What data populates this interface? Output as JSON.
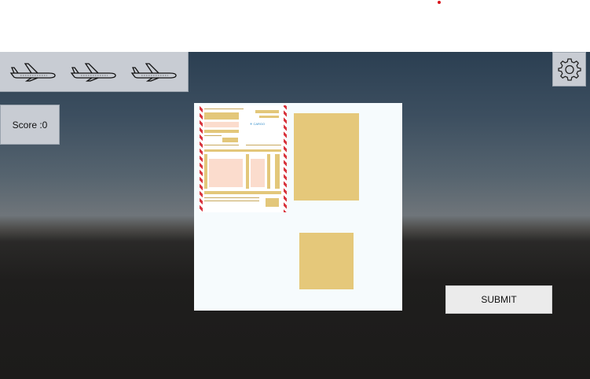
{
  "hud": {
    "score_text": "Score :0",
    "lives": [
      {
        "icon": "airplane-icon"
      },
      {
        "icon": "airplane-icon"
      },
      {
        "icon": "airplane-icon"
      }
    ],
    "settings_icon": "gear-icon"
  },
  "board": {
    "document_icon": "cargo-document-icon",
    "slots": [
      "drop-slot",
      "drop-slot"
    ]
  },
  "actions": {
    "submit_label": "SUBMIT"
  },
  "colors": {
    "hud_panel": "#c8ccd3",
    "slot": "#e5c87a",
    "accent_red": "#d9141b",
    "button": "#ebebeb"
  }
}
